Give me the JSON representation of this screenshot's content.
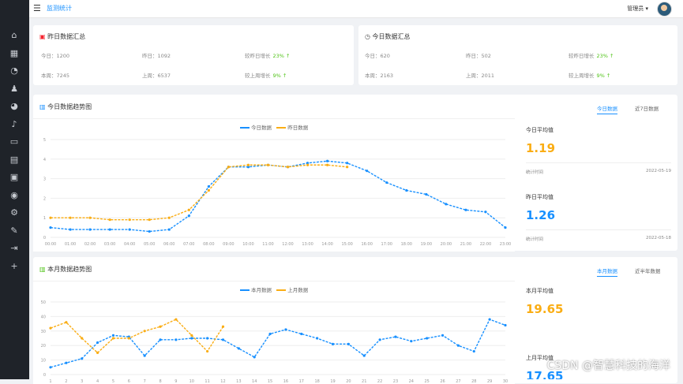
{
  "topbar": {
    "breadcrumb": "监测统计",
    "user_name": "管理员 ▾"
  },
  "sidebar": {
    "icons": [
      "home-icon",
      "table-icon",
      "chart-icon",
      "user-icon",
      "pie-icon",
      "bell-icon",
      "folder-icon",
      "file-icon",
      "calendar-icon",
      "map-icon",
      "settings-icon",
      "tool-icon",
      "export-icon",
      "plus-icon"
    ]
  },
  "cards": [
    {
      "title": "昨日数据汇总",
      "rows": [
        {
          "a": "今日：1200",
          "b": "昨日：1092",
          "pct": "较昨日增长",
          "pct_val": "23% ↑"
        },
        {
          "a": "本周：7245",
          "b": "上周：6537",
          "pct": "较上周增长",
          "pct_val": "9% ↑"
        }
      ]
    },
    {
      "title": "今日数据汇总",
      "rows": [
        {
          "a": "今日：620",
          "b": "昨日：502",
          "pct": "较昨日增长",
          "pct_val": "23% ↑"
        },
        {
          "a": "本周：2163",
          "b": "上周：2011",
          "pct": "较上周增长",
          "pct_val": "9% ↑"
        }
      ]
    }
  ],
  "section1": {
    "title": "今日数据趋势图",
    "tabs": [
      "今日数据",
      "近7日数据"
    ],
    "legend": [
      "今日数据",
      "昨日数据"
    ],
    "side": [
      {
        "label": "今日平均值",
        "value": "1.19",
        "color": "#faad14",
        "foot_l": "统计时间",
        "foot_r": "2022-05-19"
      },
      {
        "label": "昨日平均值",
        "value": "1.26",
        "color": "#1890ff",
        "foot_l": "统计时间",
        "foot_r": "2022-05-18"
      }
    ]
  },
  "section2": {
    "title": "本月数据趋势图",
    "tabs": [
      "本月数据",
      "近半年数据"
    ],
    "legend": [
      "本月数据",
      "上月数据"
    ],
    "side": [
      {
        "label": "本月平均值",
        "value": "19.65",
        "color": "#faad14"
      },
      {
        "label": "上月平均值",
        "value": "17.65",
        "color": "#1890ff"
      }
    ]
  },
  "watermark": "CSDN @智慧科技的海洋",
  "chart_data": [
    {
      "type": "line",
      "title": "今日数据趋势图",
      "categories": [
        "00:00",
        "01:00",
        "02:00",
        "03:00",
        "04:00",
        "05:00",
        "06:00",
        "07:00",
        "08:00",
        "09:00",
        "10:00",
        "11:00",
        "12:00",
        "13:00",
        "14:00",
        "15:00",
        "16:00",
        "17:00",
        "18:00",
        "19:00",
        "20:00",
        "21:00",
        "22:00",
        "23:00"
      ],
      "ylim": [
        0,
        5
      ],
      "series": [
        {
          "name": "今日数据",
          "color": "#1890ff",
          "values": [
            0.5,
            0.4,
            0.4,
            0.4,
            0.4,
            0.3,
            0.4,
            1.1,
            2.6,
            3.6,
            3.6,
            3.7,
            3.6,
            3.8,
            3.9,
            3.8,
            3.4,
            2.8,
            2.4,
            2.2,
            1.7,
            1.4,
            1.3,
            0.5
          ]
        },
        {
          "name": "昨日数据",
          "color": "#faad14",
          "values": [
            1.0,
            1.0,
            1.0,
            0.9,
            0.9,
            0.9,
            1.0,
            1.4,
            2.4,
            3.6,
            3.7,
            3.7,
            3.6,
            3.7,
            3.7,
            3.6
          ]
        }
      ]
    },
    {
      "type": "line",
      "title": "本月数据趋势图",
      "categories": [
        "1",
        "2",
        "3",
        "4",
        "5",
        "6",
        "7",
        "8",
        "9",
        "10",
        "11",
        "12",
        "13",
        "14",
        "15",
        "16",
        "17",
        "18",
        "19",
        "20",
        "21",
        "22",
        "23",
        "24",
        "25",
        "26",
        "27",
        "28",
        "29",
        "30"
      ],
      "ylim": [
        0,
        50
      ],
      "series": [
        {
          "name": "本月数据",
          "color": "#1890ff",
          "values": [
            5,
            8,
            11,
            22,
            27,
            26,
            13,
            24,
            24,
            25,
            25,
            24,
            18,
            12,
            28,
            31,
            28,
            25,
            21,
            21,
            13,
            24,
            26,
            23,
            25,
            27,
            20,
            16,
            38,
            34
          ]
        },
        {
          "name": "上月数据",
          "color": "#faad14",
          "values": [
            32,
            36,
            25,
            15,
            25,
            25,
            30,
            33,
            38,
            27,
            16,
            33
          ]
        }
      ]
    }
  ]
}
